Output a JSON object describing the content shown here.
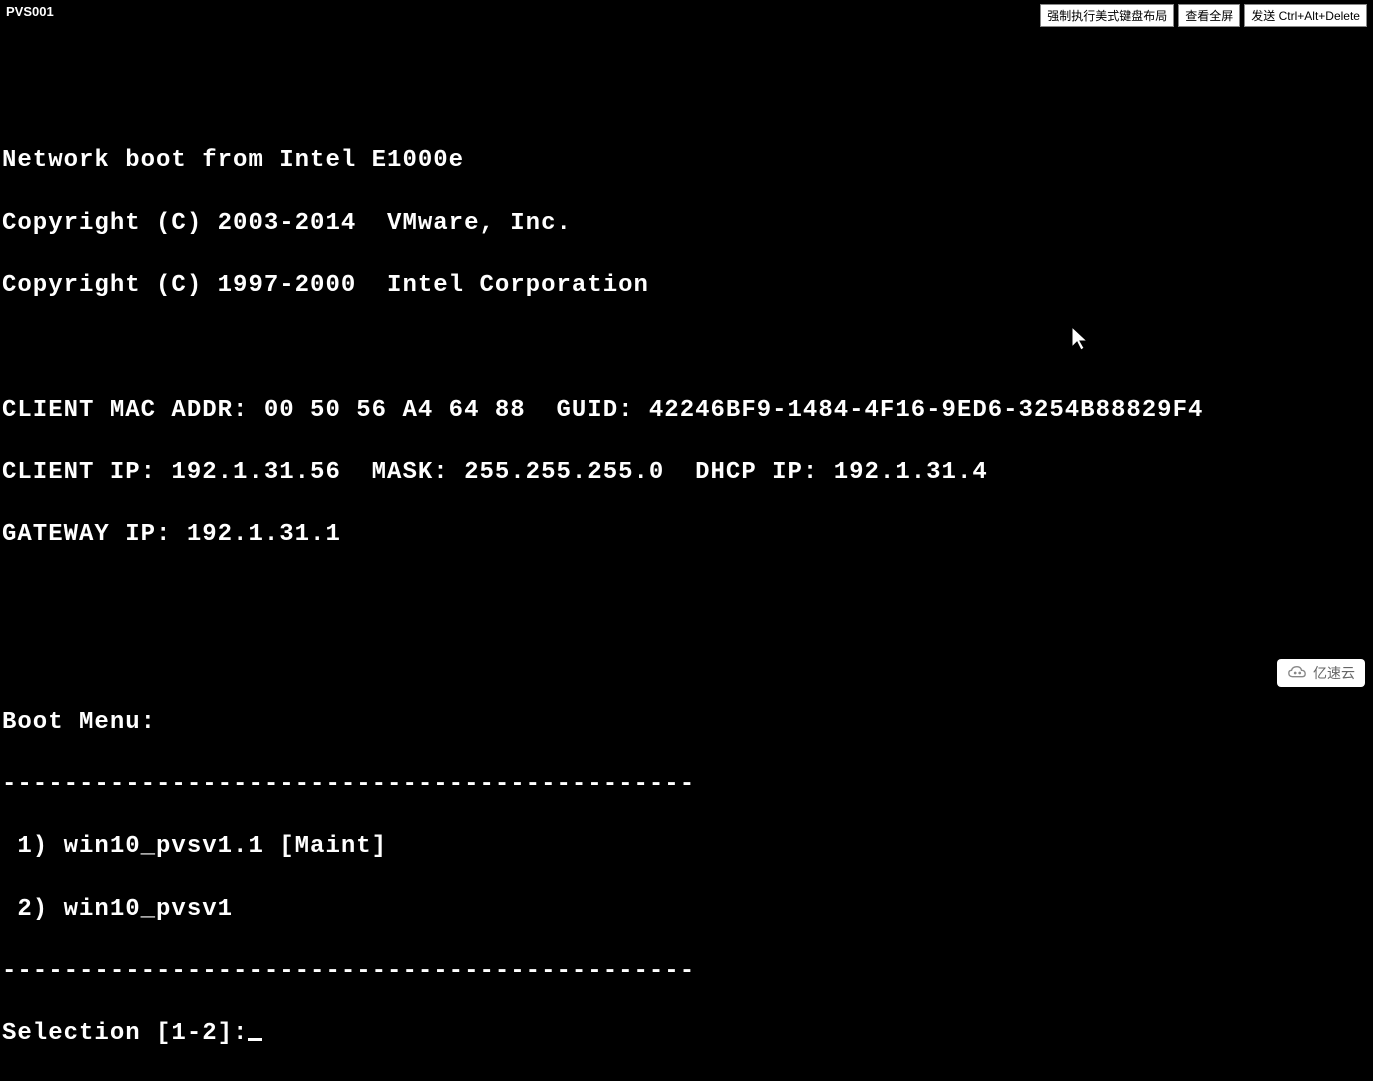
{
  "header": {
    "vm_title": "PVS001",
    "buttons": {
      "keyboard": "强制执行美式键盘布局",
      "fullscreen": "查看全屏",
      "ctrl_alt_del": "发送 Ctrl+Alt+Delete"
    }
  },
  "console": {
    "boot_line": "Network boot from Intel E1000e",
    "copyright1": "Copyright (C) 2003-2014  VMware, Inc.",
    "copyright2": "Copyright (C) 1997-2000  Intel Corporation",
    "client_mac_line": "CLIENT MAC ADDR: 00 50 56 A4 64 88  GUID: 42246BF9-1484-4F16-9ED6-3254B88829F4",
    "client_ip_line": "CLIENT IP: 192.1.31.56  MASK: 255.255.255.0  DHCP IP: 192.1.31.4",
    "gateway_line": "GATEWAY IP: 192.1.31.1",
    "boot_menu_title": "Boot Menu:",
    "separator": "---------------------------------------------",
    "menu_items": [
      " 1) win10_pvsv1.1 [Maint]",
      " 2) win10_pvsv1"
    ],
    "selection_prompt": "Selection [1-2]:"
  },
  "watermark": {
    "text": "亿速云"
  }
}
